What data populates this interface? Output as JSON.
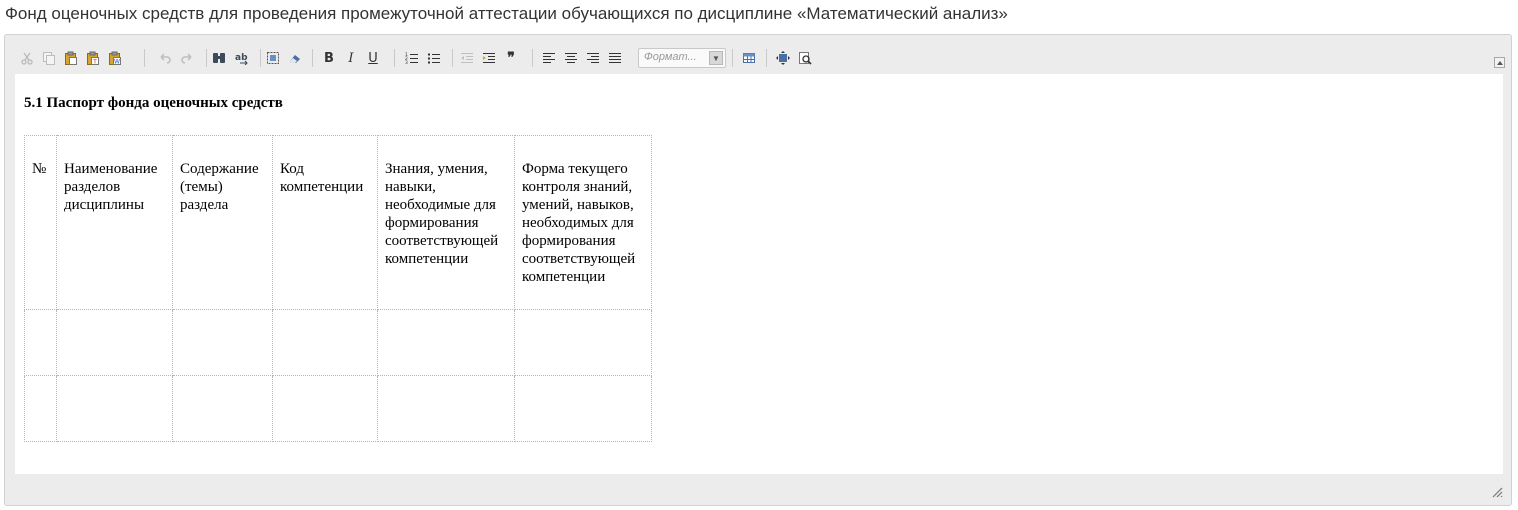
{
  "page": {
    "title": "Фонд оценочных средств для проведения промежуточной аттестации обучающихся по дисциплине «Математический анализ»"
  },
  "toolbar": {
    "format_placeholder": "Формат...",
    "bold_label": "B",
    "italic_label": "I",
    "underline_label": "U",
    "blockquote_label": "❞",
    "icons": [
      "cut-icon",
      "copy-icon",
      "paste-icon",
      "paste-text-icon",
      "paste-word-icon",
      "undo-icon",
      "redo-icon",
      "find-icon",
      "replace-icon",
      "select-all-icon",
      "remove-format-icon",
      "bold-icon",
      "italic-icon",
      "underline-icon",
      "numbered-list-icon",
      "bulleted-list-icon",
      "outdent-icon",
      "indent-icon",
      "blockquote-icon",
      "align-left-icon",
      "align-center-icon",
      "align-right-icon",
      "justify-icon",
      "table-icon",
      "maximize-icon",
      "preview-icon"
    ]
  },
  "document": {
    "heading": "5.1 Паспорт фонда оценочных средств",
    "table": {
      "headers": [
        "№",
        "Наименование разделов дисциплины",
        "Содержание (темы) раздела",
        "Код компетенции",
        "Знания, умения, навыки, необходимые для формирования соответствующей компетенции",
        "Форма текущего контроля знаний, умений, навыков, необходимых для формирования соответствующей компетенции"
      ],
      "rows": [
        [
          "",
          "",
          "",
          "",
          "",
          ""
        ],
        [
          "",
          "",
          "",
          "",
          "",
          ""
        ]
      ]
    }
  },
  "colors": {
    "editor_chrome": "#ececec",
    "editor_border": "#d1d1d1",
    "icon_blue": "#4a6fa5",
    "icon_gold": "#d6a531"
  }
}
